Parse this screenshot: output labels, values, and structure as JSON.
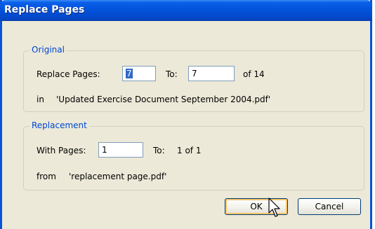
{
  "window": {
    "title": "Replace Pages"
  },
  "original": {
    "legend": "Original",
    "replace_label": "Replace Pages:",
    "from_value": "7",
    "to_label": "To:",
    "to_value": "7",
    "of_text": "of 14",
    "in_label": "in",
    "filename": "'Updated Exercise Document September 2004.pdf'"
  },
  "replacement": {
    "legend": "Replacement",
    "with_label": "With Pages:",
    "with_value": "1",
    "to_label": "To:",
    "to_text": "1 of 1",
    "from_label": "from",
    "filename": "'replacement page.pdf'"
  },
  "buttons": {
    "ok": "OK",
    "cancel": "Cancel"
  },
  "colors": {
    "title_bar": "#0453dc",
    "group_legend": "#0046d5",
    "dialog_bg": "#ece9d8"
  },
  "icons": {
    "pointer": "arrow-cursor-icon"
  }
}
